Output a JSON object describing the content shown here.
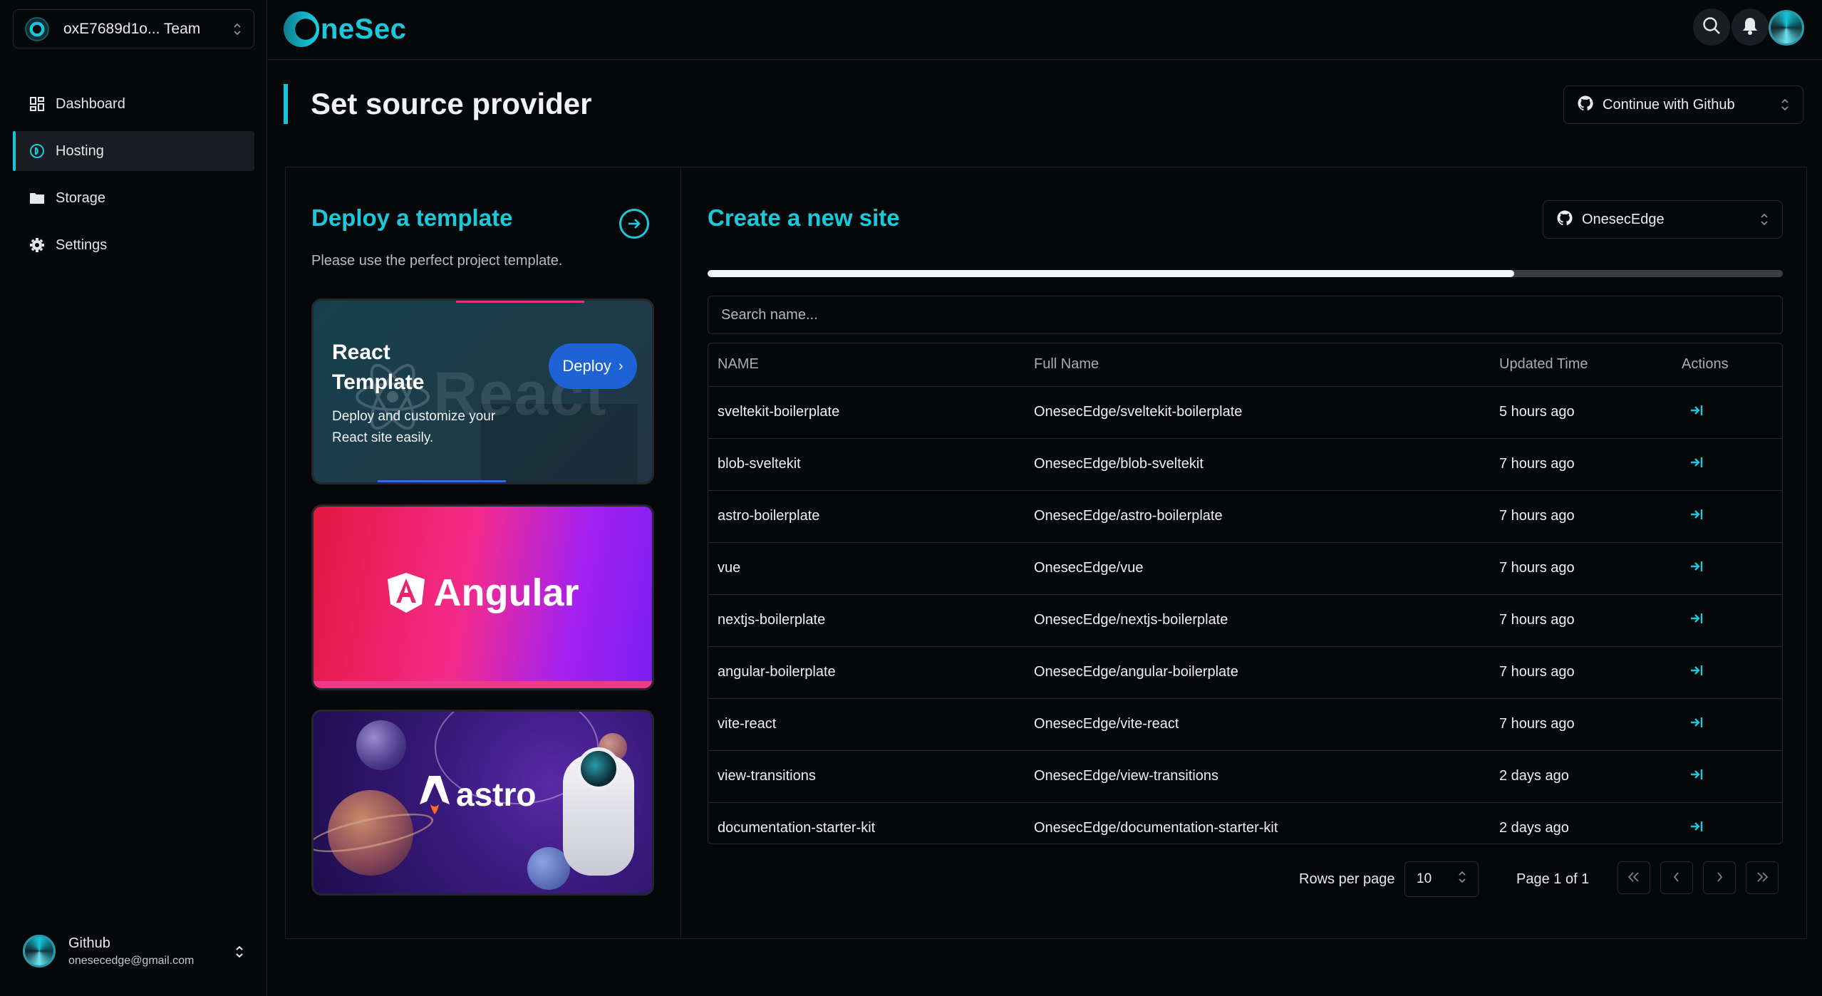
{
  "team": {
    "name": "oxE7689d1o... Team"
  },
  "sidebar": {
    "items": [
      {
        "label": "Dashboard",
        "icon": "dashboard-grid-icon"
      },
      {
        "label": "Hosting",
        "icon": "hosting-icon",
        "active": true
      },
      {
        "label": "Storage",
        "icon": "folder-icon"
      },
      {
        "label": "Settings",
        "icon": "gear-icon"
      }
    ]
  },
  "user": {
    "name": "Github",
    "email": "onesecedge@gmail.com"
  },
  "brand": {
    "letter": "O",
    "text": "neSec",
    "color": "#19c9dc"
  },
  "header": {
    "title": "Set source provider",
    "provider_select": "Continue with Github"
  },
  "templates": {
    "title": "Deploy a template",
    "subtitle": "Please use the perfect project template.",
    "react": {
      "title": "React Template",
      "description": "Deploy and customize your React site easily.",
      "watermark": "React",
      "deploy_label": "Deploy"
    },
    "angular": {
      "name": "Angular"
    },
    "astro": {
      "name": "astro"
    }
  },
  "create": {
    "title": "Create a new site",
    "org_select": "OnesecEdge",
    "progress": 0.75,
    "search_placeholder": "Search name..."
  },
  "table": {
    "columns": [
      "NAME",
      "Full Name",
      "Updated Time",
      "Actions"
    ],
    "rows": [
      {
        "name": "sveltekit-boilerplate",
        "full_name": "OnesecEdge/sveltekit-boilerplate",
        "updated": "5 hours ago"
      },
      {
        "name": "blob-sveltekit",
        "full_name": "OnesecEdge/blob-sveltekit",
        "updated": "7 hours ago"
      },
      {
        "name": "astro-boilerplate",
        "full_name": "OnesecEdge/astro-boilerplate",
        "updated": "7 hours ago"
      },
      {
        "name": "vue",
        "full_name": "OnesecEdge/vue",
        "updated": "7 hours ago"
      },
      {
        "name": "nextjs-boilerplate",
        "full_name": "OnesecEdge/nextjs-boilerplate",
        "updated": "7 hours ago"
      },
      {
        "name": "angular-boilerplate",
        "full_name": "OnesecEdge/angular-boilerplate",
        "updated": "7 hours ago"
      },
      {
        "name": "vite-react",
        "full_name": "OnesecEdge/vite-react",
        "updated": "7 hours ago"
      },
      {
        "name": "view-transitions",
        "full_name": "OnesecEdge/view-transitions",
        "updated": "2 days ago"
      },
      {
        "name": "documentation-starter-kit",
        "full_name": "OnesecEdge/documentation-starter-kit",
        "updated": "2 days ago"
      }
    ]
  },
  "pagination": {
    "rows_per_page_label": "Rows per page",
    "rows_per_page": "10",
    "page_info": "Page 1 of 1"
  },
  "colors": {
    "accent": "#19c9dc",
    "background": "#060709",
    "deploy_button": "#1d63d6"
  }
}
